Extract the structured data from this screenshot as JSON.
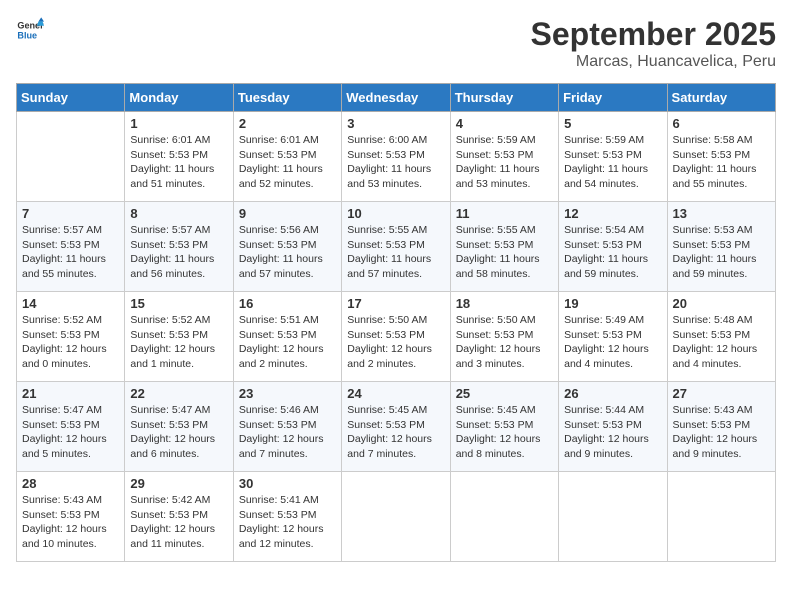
{
  "header": {
    "logo_text_general": "General",
    "logo_text_blue": "Blue",
    "month": "September 2025",
    "location": "Marcas, Huancavelica, Peru"
  },
  "days_of_week": [
    "Sunday",
    "Monday",
    "Tuesday",
    "Wednesday",
    "Thursday",
    "Friday",
    "Saturday"
  ],
  "weeks": [
    [
      {
        "day": "",
        "sunrise": "",
        "sunset": "",
        "daylight": ""
      },
      {
        "day": "1",
        "sunrise": "Sunrise: 6:01 AM",
        "sunset": "Sunset: 5:53 PM",
        "daylight": "Daylight: 11 hours and 51 minutes."
      },
      {
        "day": "2",
        "sunrise": "Sunrise: 6:01 AM",
        "sunset": "Sunset: 5:53 PM",
        "daylight": "Daylight: 11 hours and 52 minutes."
      },
      {
        "day": "3",
        "sunrise": "Sunrise: 6:00 AM",
        "sunset": "Sunset: 5:53 PM",
        "daylight": "Daylight: 11 hours and 53 minutes."
      },
      {
        "day": "4",
        "sunrise": "Sunrise: 5:59 AM",
        "sunset": "Sunset: 5:53 PM",
        "daylight": "Daylight: 11 hours and 53 minutes."
      },
      {
        "day": "5",
        "sunrise": "Sunrise: 5:59 AM",
        "sunset": "Sunset: 5:53 PM",
        "daylight": "Daylight: 11 hours and 54 minutes."
      },
      {
        "day": "6",
        "sunrise": "Sunrise: 5:58 AM",
        "sunset": "Sunset: 5:53 PM",
        "daylight": "Daylight: 11 hours and 55 minutes."
      }
    ],
    [
      {
        "day": "7",
        "sunrise": "Sunrise: 5:57 AM",
        "sunset": "Sunset: 5:53 PM",
        "daylight": "Daylight: 11 hours and 55 minutes."
      },
      {
        "day": "8",
        "sunrise": "Sunrise: 5:57 AM",
        "sunset": "Sunset: 5:53 PM",
        "daylight": "Daylight: 11 hours and 56 minutes."
      },
      {
        "day": "9",
        "sunrise": "Sunrise: 5:56 AM",
        "sunset": "Sunset: 5:53 PM",
        "daylight": "Daylight: 11 hours and 57 minutes."
      },
      {
        "day": "10",
        "sunrise": "Sunrise: 5:55 AM",
        "sunset": "Sunset: 5:53 PM",
        "daylight": "Daylight: 11 hours and 57 minutes."
      },
      {
        "day": "11",
        "sunrise": "Sunrise: 5:55 AM",
        "sunset": "Sunset: 5:53 PM",
        "daylight": "Daylight: 11 hours and 58 minutes."
      },
      {
        "day": "12",
        "sunrise": "Sunrise: 5:54 AM",
        "sunset": "Sunset: 5:53 PM",
        "daylight": "Daylight: 11 hours and 59 minutes."
      },
      {
        "day": "13",
        "sunrise": "Sunrise: 5:53 AM",
        "sunset": "Sunset: 5:53 PM",
        "daylight": "Daylight: 11 hours and 59 minutes."
      }
    ],
    [
      {
        "day": "14",
        "sunrise": "Sunrise: 5:52 AM",
        "sunset": "Sunset: 5:53 PM",
        "daylight": "Daylight: 12 hours and 0 minutes."
      },
      {
        "day": "15",
        "sunrise": "Sunrise: 5:52 AM",
        "sunset": "Sunset: 5:53 PM",
        "daylight": "Daylight: 12 hours and 1 minute."
      },
      {
        "day": "16",
        "sunrise": "Sunrise: 5:51 AM",
        "sunset": "Sunset: 5:53 PM",
        "daylight": "Daylight: 12 hours and 2 minutes."
      },
      {
        "day": "17",
        "sunrise": "Sunrise: 5:50 AM",
        "sunset": "Sunset: 5:53 PM",
        "daylight": "Daylight: 12 hours and 2 minutes."
      },
      {
        "day": "18",
        "sunrise": "Sunrise: 5:50 AM",
        "sunset": "Sunset: 5:53 PM",
        "daylight": "Daylight: 12 hours and 3 minutes."
      },
      {
        "day": "19",
        "sunrise": "Sunrise: 5:49 AM",
        "sunset": "Sunset: 5:53 PM",
        "daylight": "Daylight: 12 hours and 4 minutes."
      },
      {
        "day": "20",
        "sunrise": "Sunrise: 5:48 AM",
        "sunset": "Sunset: 5:53 PM",
        "daylight": "Daylight: 12 hours and 4 minutes."
      }
    ],
    [
      {
        "day": "21",
        "sunrise": "Sunrise: 5:47 AM",
        "sunset": "Sunset: 5:53 PM",
        "daylight": "Daylight: 12 hours and 5 minutes."
      },
      {
        "day": "22",
        "sunrise": "Sunrise: 5:47 AM",
        "sunset": "Sunset: 5:53 PM",
        "daylight": "Daylight: 12 hours and 6 minutes."
      },
      {
        "day": "23",
        "sunrise": "Sunrise: 5:46 AM",
        "sunset": "Sunset: 5:53 PM",
        "daylight": "Daylight: 12 hours and 7 minutes."
      },
      {
        "day": "24",
        "sunrise": "Sunrise: 5:45 AM",
        "sunset": "Sunset: 5:53 PM",
        "daylight": "Daylight: 12 hours and 7 minutes."
      },
      {
        "day": "25",
        "sunrise": "Sunrise: 5:45 AM",
        "sunset": "Sunset: 5:53 PM",
        "daylight": "Daylight: 12 hours and 8 minutes."
      },
      {
        "day": "26",
        "sunrise": "Sunrise: 5:44 AM",
        "sunset": "Sunset: 5:53 PM",
        "daylight": "Daylight: 12 hours and 9 minutes."
      },
      {
        "day": "27",
        "sunrise": "Sunrise: 5:43 AM",
        "sunset": "Sunset: 5:53 PM",
        "daylight": "Daylight: 12 hours and 9 minutes."
      }
    ],
    [
      {
        "day": "28",
        "sunrise": "Sunrise: 5:43 AM",
        "sunset": "Sunset: 5:53 PM",
        "daylight": "Daylight: 12 hours and 10 minutes."
      },
      {
        "day": "29",
        "sunrise": "Sunrise: 5:42 AM",
        "sunset": "Sunset: 5:53 PM",
        "daylight": "Daylight: 12 hours and 11 minutes."
      },
      {
        "day": "30",
        "sunrise": "Sunrise: 5:41 AM",
        "sunset": "Sunset: 5:53 PM",
        "daylight": "Daylight: 12 hours and 12 minutes."
      },
      {
        "day": "",
        "sunrise": "",
        "sunset": "",
        "daylight": ""
      },
      {
        "day": "",
        "sunrise": "",
        "sunset": "",
        "daylight": ""
      },
      {
        "day": "",
        "sunrise": "",
        "sunset": "",
        "daylight": ""
      },
      {
        "day": "",
        "sunrise": "",
        "sunset": "",
        "daylight": ""
      }
    ]
  ]
}
